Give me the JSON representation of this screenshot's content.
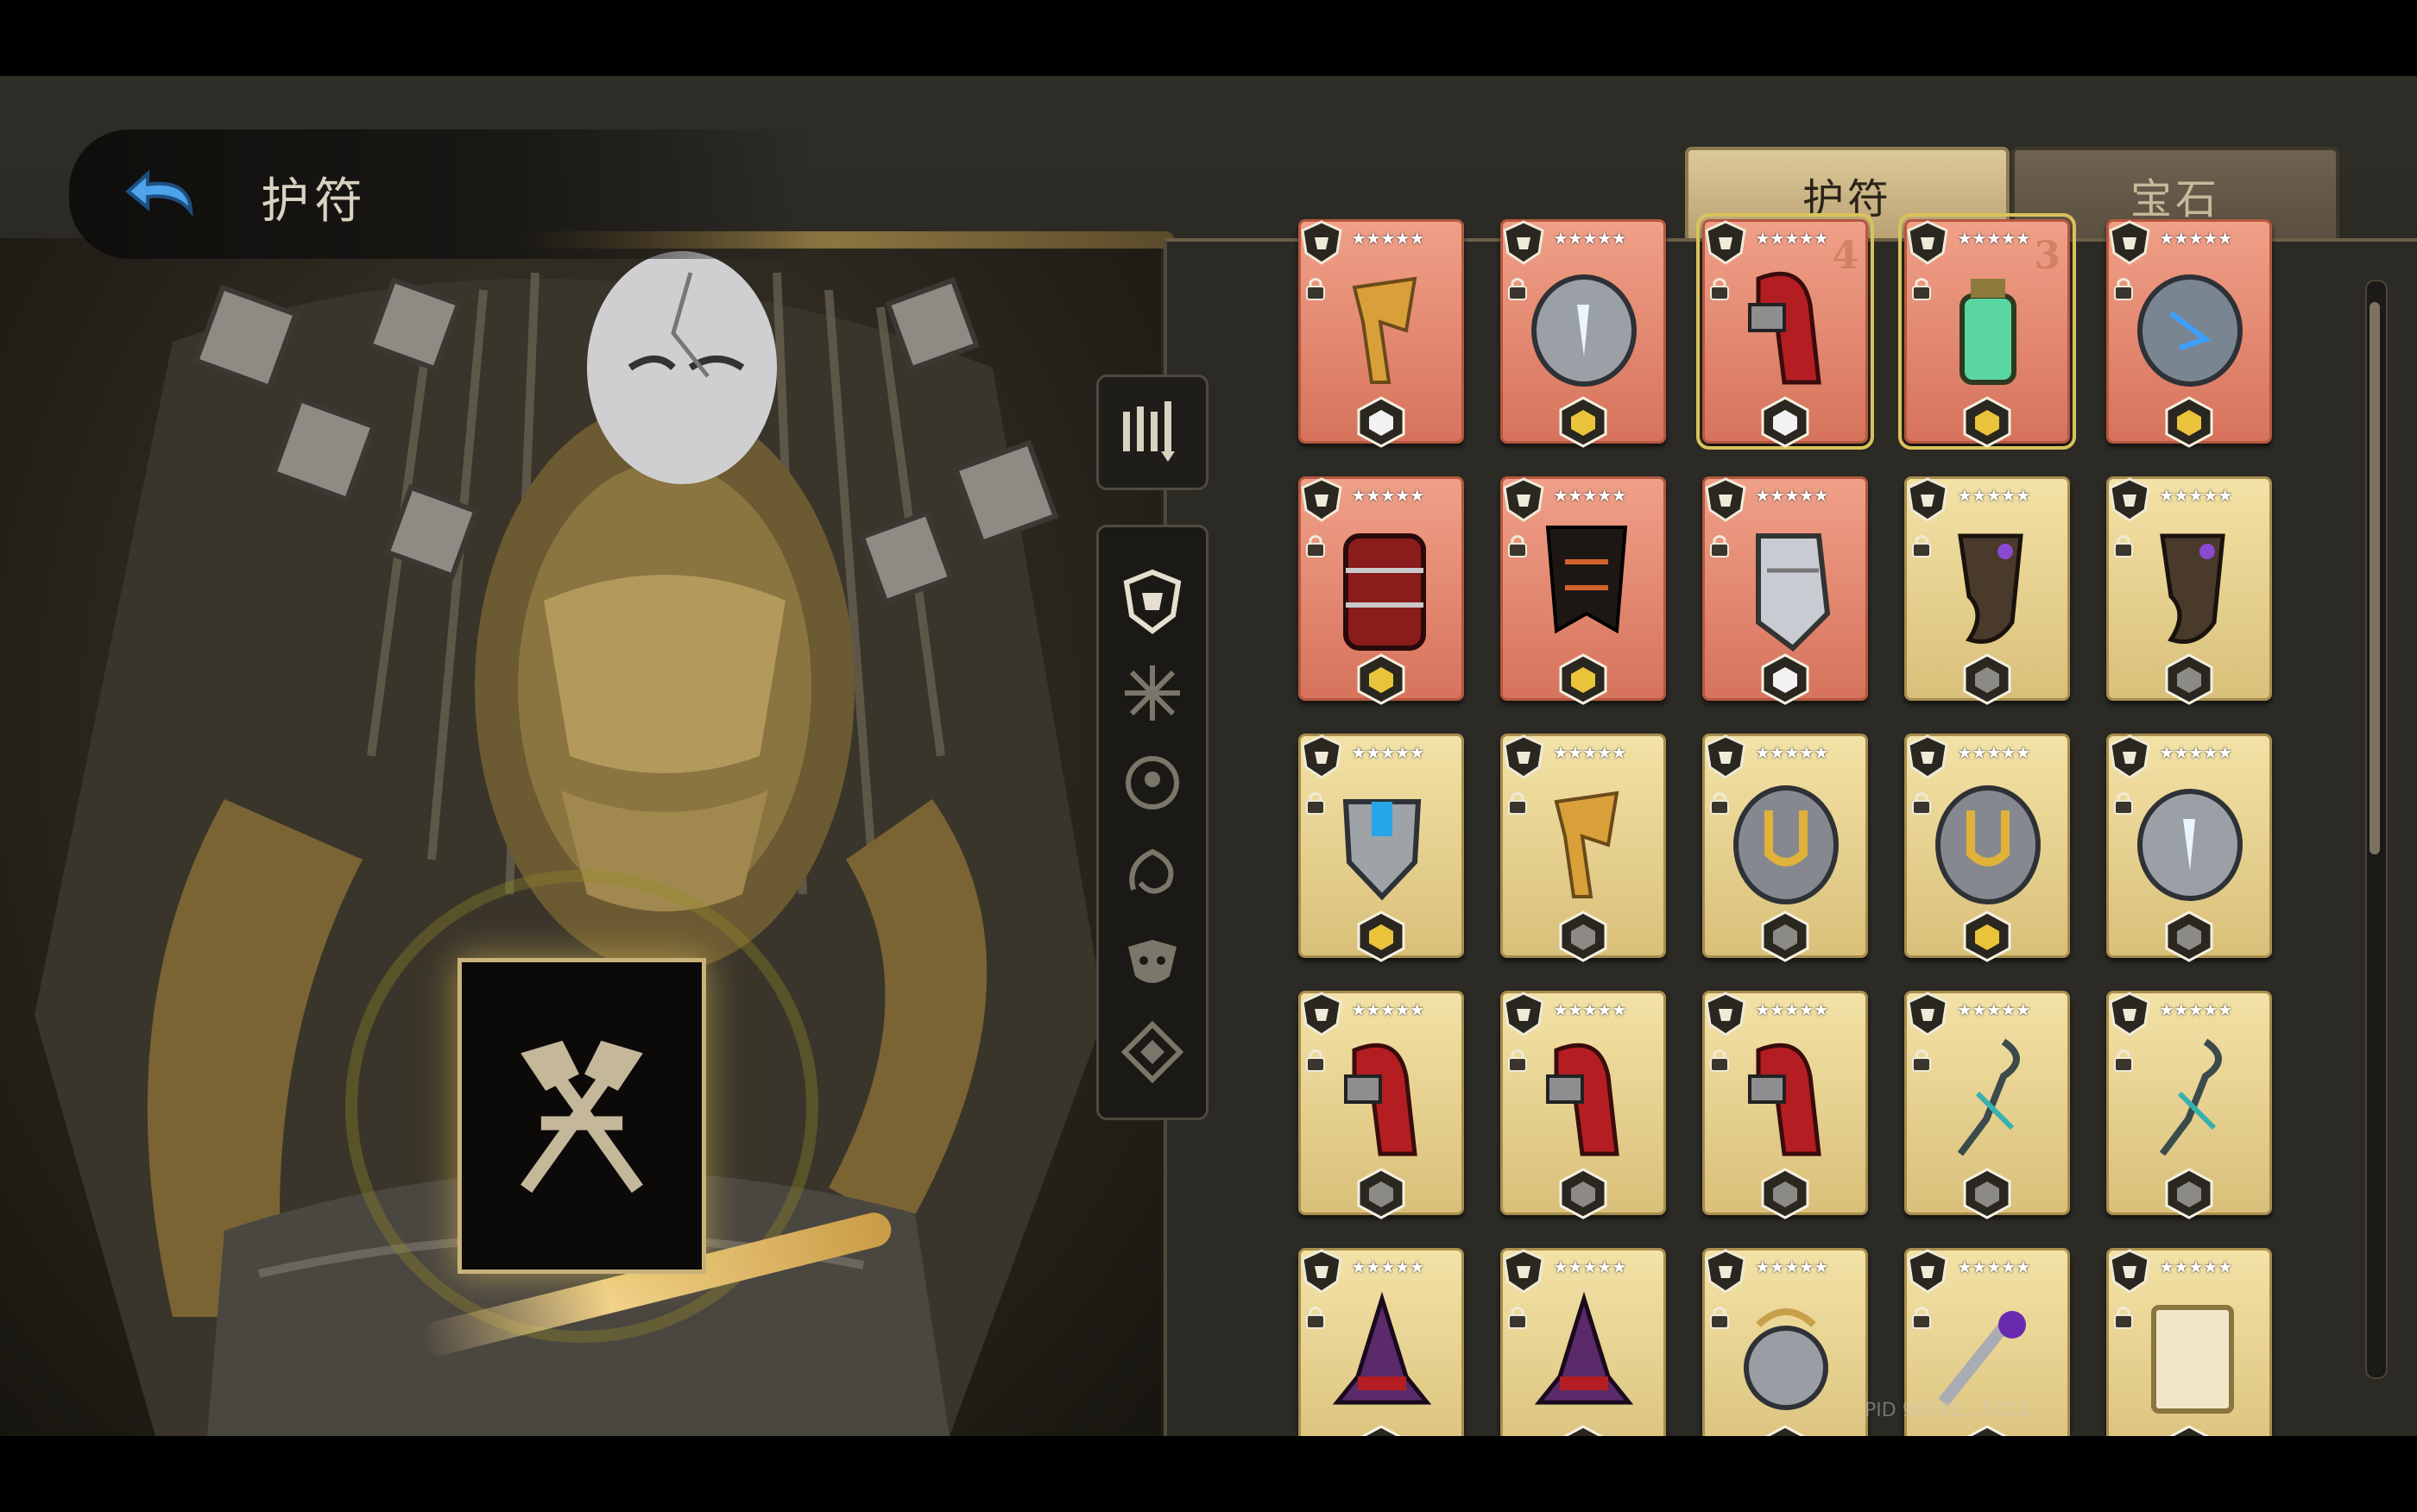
{
  "header": {
    "title": "护符",
    "back_icon": "back-arrow-icon"
  },
  "tabs": [
    {
      "label": "护符",
      "active": true
    },
    {
      "label": "宝石",
      "active": false
    }
  ],
  "sidebar": {
    "sort_icon": "sort-filter-icon",
    "categories": [
      {
        "icon": "shield-crest-icon",
        "selected": true
      },
      {
        "icon": "thorn-burst-icon",
        "selected": false
      },
      {
        "icon": "hand-orb-icon",
        "selected": false
      },
      {
        "icon": "rune-scroll-icon",
        "selected": false
      },
      {
        "icon": "jester-mask-icon",
        "selected": false
      },
      {
        "icon": "diamond-knot-icon",
        "selected": false
      }
    ]
  },
  "selected_item": {
    "icon": "crossed-axes-icon"
  },
  "grid": {
    "rows": [
      [
        {
          "item": "banner-claw",
          "bg": "red",
          "stars": "★★★★★",
          "rarity": "white",
          "level": ""
        },
        {
          "item": "rune-stone",
          "bg": "red",
          "stars": "★★★★★",
          "rarity": "gold",
          "level": ""
        },
        {
          "item": "red-gauntlet",
          "bg": "red",
          "stars": "★★★★★",
          "rarity": "white",
          "level": "4",
          "highlight": true
        },
        {
          "item": "green-lantern",
          "bg": "red",
          "stars": "★★★★★",
          "rarity": "gold",
          "level": "3",
          "highlight": true
        },
        {
          "item": "blue-rune-stone",
          "bg": "red",
          "stars": "★★★★★",
          "rarity": "gold",
          "level": ""
        }
      ],
      [
        {
          "item": "red-armor-glove",
          "bg": "red",
          "stars": "★★★★★",
          "rarity": "gold",
          "level": ""
        },
        {
          "item": "dark-banner",
          "bg": "red",
          "stars": "★★★★★",
          "rarity": "gold",
          "level": ""
        },
        {
          "item": "steel-gauntlet",
          "bg": "red",
          "stars": "★★★★★",
          "rarity": "white",
          "level": ""
        },
        {
          "item": "purple-horn",
          "bg": "gold",
          "stars": "★★★★★",
          "rarity": "grey",
          "level": ""
        },
        {
          "item": "purple-horn",
          "bg": "gold",
          "stars": "★★★★★",
          "rarity": "grey",
          "level": ""
        }
      ],
      [
        {
          "item": "blue-crystal-crest",
          "bg": "gold",
          "stars": "★★★★★",
          "rarity": "gold",
          "level": ""
        },
        {
          "item": "banner-claw",
          "bg": "gold",
          "stars": "★★★★★",
          "rarity": "grey",
          "level": ""
        },
        {
          "item": "gold-u-stone",
          "bg": "gold",
          "stars": "★★★★★",
          "rarity": "grey",
          "level": ""
        },
        {
          "item": "gold-u-stone",
          "bg": "gold",
          "stars": "★★★★★",
          "rarity": "gold",
          "level": ""
        },
        {
          "item": "rune-stone",
          "bg": "gold",
          "stars": "★★★★★",
          "rarity": "grey",
          "level": ""
        }
      ],
      [
        {
          "item": "red-gauntlet",
          "bg": "gold",
          "stars": "★★★★★",
          "rarity": "grey",
          "level": ""
        },
        {
          "item": "red-gauntlet",
          "bg": "gold",
          "stars": "★★★★★",
          "rarity": "grey",
          "level": ""
        },
        {
          "item": "red-gauntlet",
          "bg": "gold",
          "stars": "★★★★★",
          "rarity": "grey",
          "level": ""
        },
        {
          "item": "chain-hook",
          "bg": "gold",
          "stars": "★★★★★",
          "rarity": "grey",
          "level": ""
        },
        {
          "item": "chain-hook",
          "bg": "gold",
          "stars": "★★★★★",
          "rarity": "grey",
          "level": ""
        }
      ],
      [
        {
          "item": "purple-hat",
          "bg": "gold",
          "stars": "★★★★★",
          "rarity": "grey",
          "level": ""
        },
        {
          "item": "purple-hat",
          "bg": "gold",
          "stars": "★★★★★",
          "rarity": "grey",
          "level": ""
        },
        {
          "item": "gear-hand",
          "bg": "gold",
          "stars": "★★★★★",
          "rarity": "grey",
          "level": ""
        },
        {
          "item": "purple-eye-wand",
          "bg": "gold",
          "stars": "★★★★★",
          "rarity": "grey",
          "level": ""
        },
        {
          "item": "scroll-map",
          "bg": "gold",
          "stars": "★★★★★",
          "rarity": "grey",
          "level": ""
        }
      ]
    ]
  },
  "pid_text": "PID 96082…5012",
  "colors": {
    "red_card": "#e08a72",
    "gold_card": "#e6d18f",
    "tab_active": "#cdb888",
    "accent_gold": "#d9c25a"
  }
}
